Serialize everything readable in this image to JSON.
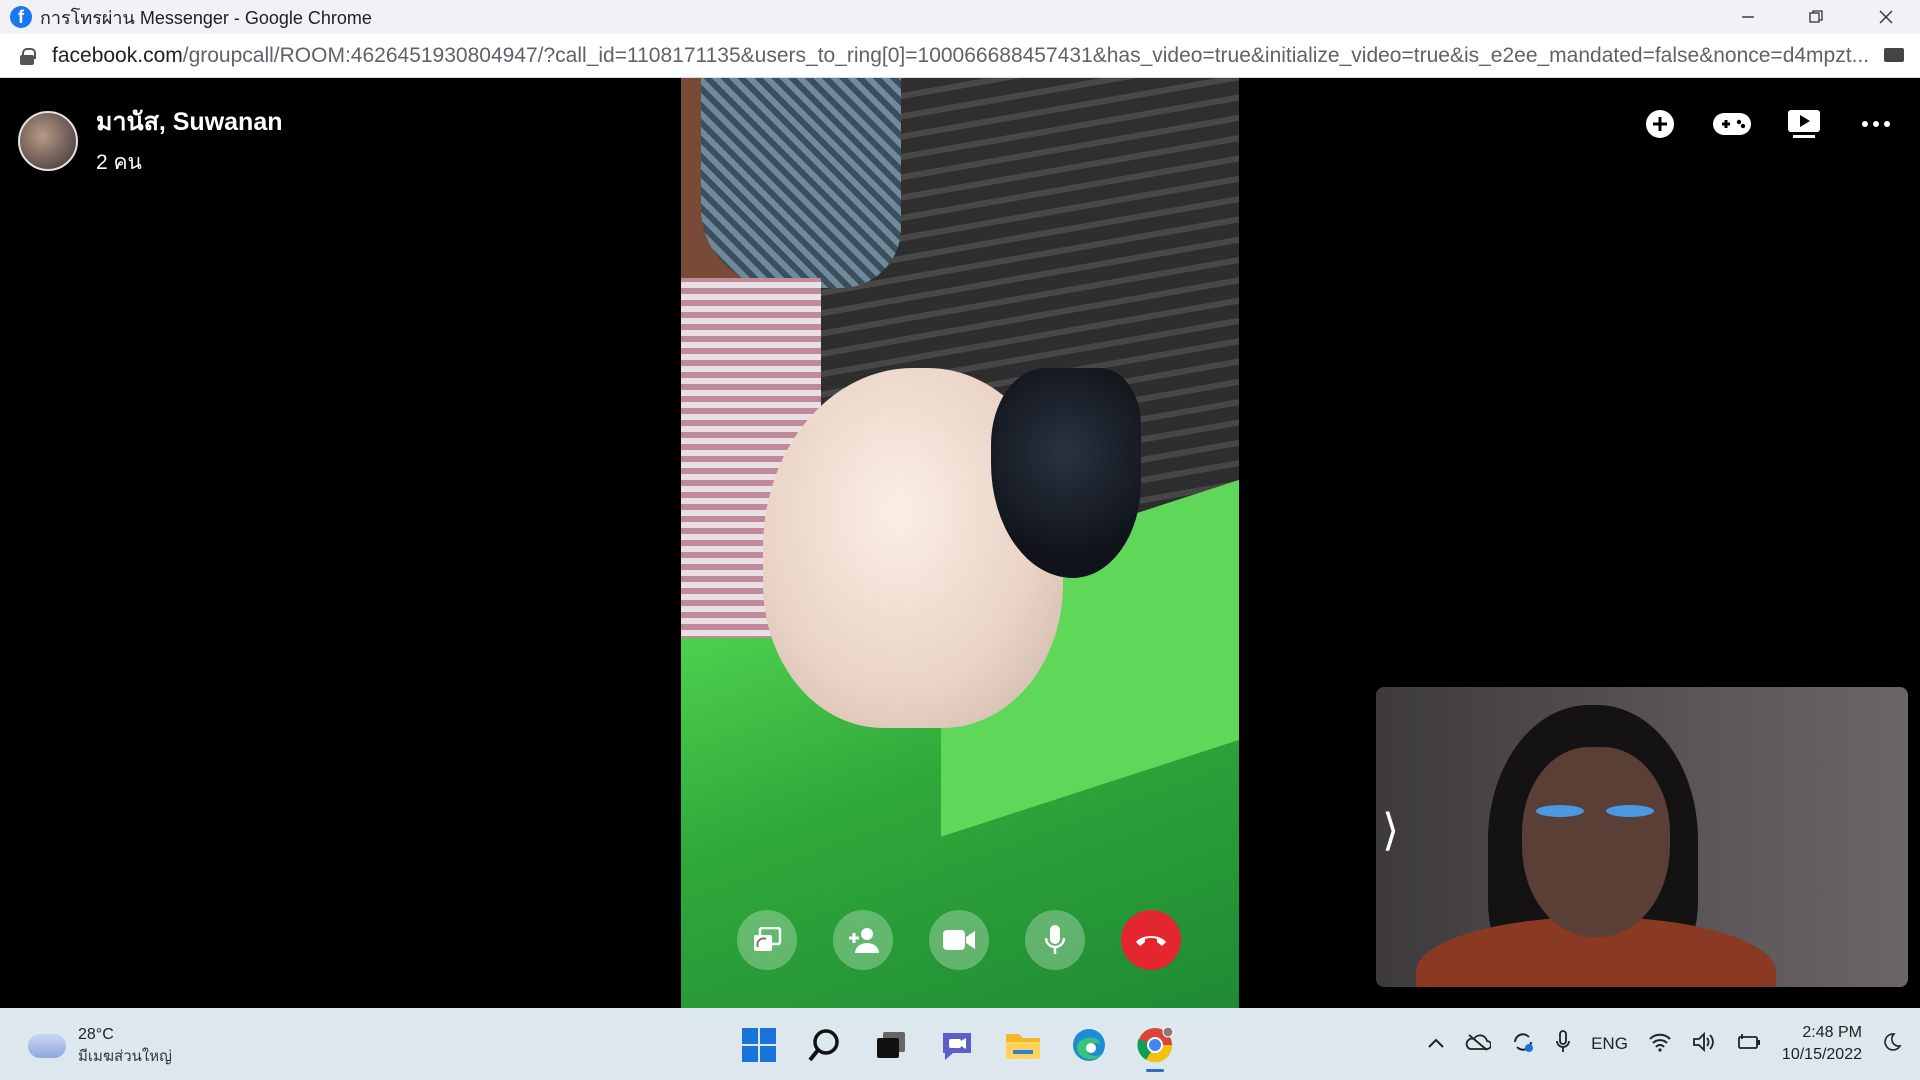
{
  "browser": {
    "title": "การโทรผ่าน Messenger - Google Chrome",
    "url_host": "facebook.com",
    "url_path": "/groupcall/ROOM:4626451930804947/?call_id=1108171135&users_to_ring[0]=100066688457431&has_video=true&initialize_video=true&is_e2ee_mandated=false&nonce=d4mpzt..."
  },
  "call": {
    "title": "มานัส, Suwanan",
    "participants": "2 คน",
    "top_actions": [
      "add-icon",
      "game-controller-icon",
      "watch-together-icon",
      "more-icon"
    ],
    "controls": [
      "share-screen-icon",
      "add-person-icon",
      "video-camera-icon",
      "microphone-icon",
      "end-call-icon"
    ],
    "end_call_color": "#e4262e"
  },
  "taskbar": {
    "weather_temp": "28°C",
    "weather_desc": "มีเมฆส่วนใหญ่",
    "language": "ENG",
    "time": "2:48 PM",
    "date": "10/15/2022",
    "apps": [
      "windows-start-icon",
      "search-icon",
      "task-view-icon",
      "teams-chat-icon",
      "file-explorer-icon",
      "edge-icon",
      "chrome-icon"
    ]
  }
}
